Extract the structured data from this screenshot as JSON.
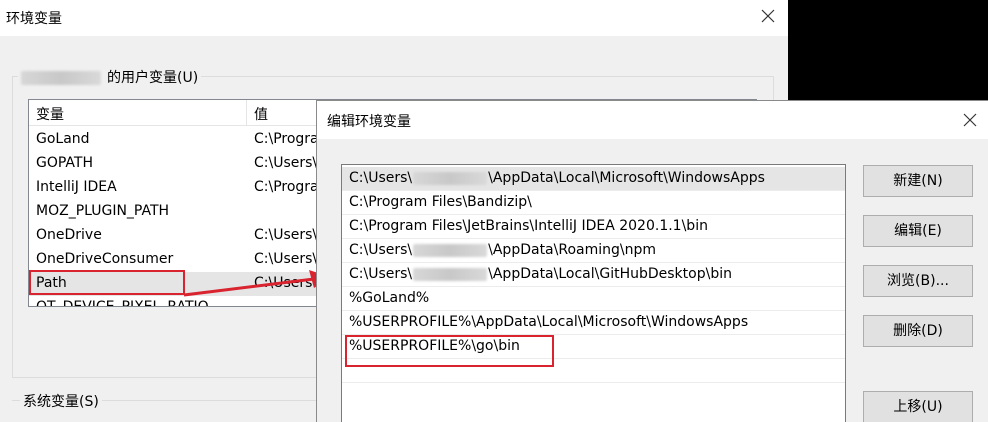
{
  "back_dialog": {
    "title": "环境变量",
    "user_group_label": "的用户变量(U)",
    "columns": [
      "变量",
      "值"
    ],
    "rows": [
      {
        "name": "GoLand",
        "value": "C:\\Progra"
      },
      {
        "name": "GOPATH",
        "value": "C:\\Users\\"
      },
      {
        "name": "IntelliJ IDEA",
        "value": "C:\\Progra"
      },
      {
        "name": "MOZ_PLUGIN_PATH",
        "value": ""
      },
      {
        "name": "OneDrive",
        "value": "C:\\Users\\"
      },
      {
        "name": "OneDriveConsumer",
        "value": "C:\\Users\\"
      },
      {
        "name": "Path",
        "value": "C:\\Users"
      },
      {
        "name": "QT_DEVICE_PIXEL_RATIO",
        "value": ""
      }
    ],
    "selected_row": "Path",
    "system_group_label": "系统变量(S)"
  },
  "front_dialog": {
    "title": "编辑环境变量",
    "entries": [
      {
        "prefix": "C:\\Users\\",
        "suffix": "\\AppData\\Local\\Microsoft\\WindowsApps"
      },
      {
        "prefix": "C:\\Program Files\\Bandizip\\",
        "suffix": ""
      },
      {
        "prefix": "C:\\Program Files\\JetBrains\\IntelliJ IDEA 2020.1.1\\bin",
        "suffix": ""
      },
      {
        "prefix": "C:\\Users\\",
        "suffix": "\\AppData\\Roaming\\npm"
      },
      {
        "prefix": "C:\\Users\\",
        "suffix": "\\AppData\\Local\\GitHubDesktop\\bin"
      },
      {
        "prefix": "%GoLand%",
        "suffix": ""
      },
      {
        "prefix": "%USERPROFILE%\\AppData\\Local\\Microsoft\\WindowsApps",
        "suffix": ""
      },
      {
        "prefix": "%USERPROFILE%\\go\\bin",
        "suffix": ""
      }
    ],
    "buttons": {
      "new": "新建(N)",
      "edit": "编辑(E)",
      "browse": "浏览(B)...",
      "delete": "删除(D)",
      "move_up": "上移(U)"
    }
  },
  "colors": {
    "highlight_red": "#d9232e",
    "selection_gray": "#e5e5e5"
  },
  "icons": [
    "close-icon",
    "arrow-icon"
  ]
}
